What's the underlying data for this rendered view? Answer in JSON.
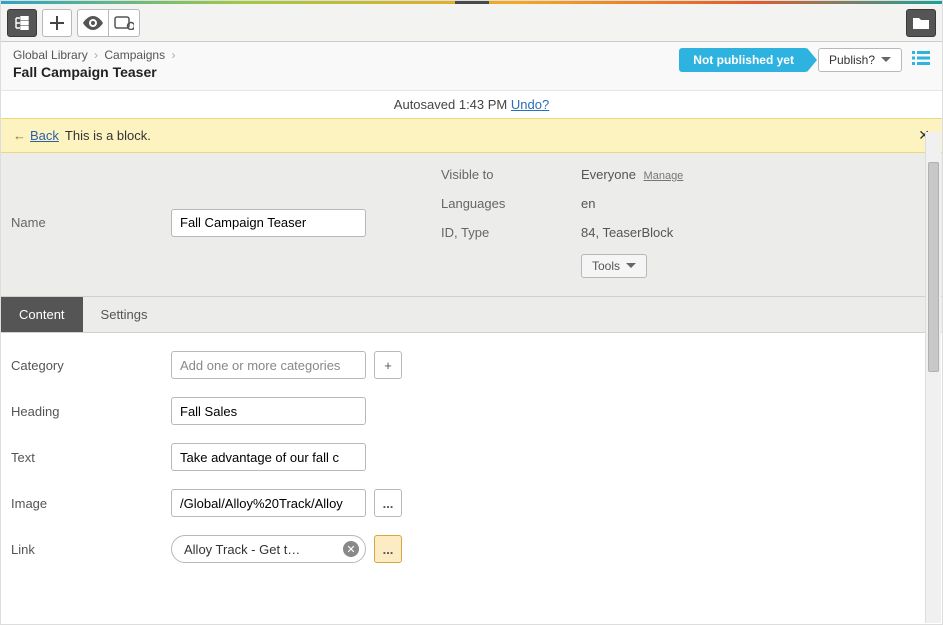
{
  "breadcrumb": {
    "a": "Global Library",
    "b": "Campaigns"
  },
  "page": {
    "title": "Fall Campaign Teaser"
  },
  "status": {
    "pill": "Not published yet",
    "publish": "Publish?"
  },
  "autosave": {
    "prefix": "Autosaved 1:43 PM",
    "undo": "Undo?"
  },
  "notice": {
    "back": "Back",
    "text": "This is a block."
  },
  "props": {
    "name_label": "Name",
    "name_value": "Fall Campaign Teaser",
    "visible_label": "Visible to",
    "visible_value": "Everyone",
    "manage": "Manage",
    "lang_label": "Languages",
    "lang_value": "en",
    "idtype_label": "ID, Type",
    "idtype_value": "84, TeaserBlock",
    "tools": "Tools"
  },
  "tabs": {
    "content": "Content",
    "settings": "Settings"
  },
  "form": {
    "category_label": "Category",
    "category_placeholder": "Add one or more categories",
    "heading_label": "Heading",
    "heading_value": "Fall Sales",
    "text_label": "Text",
    "text_value": "Take advantage of our fall c",
    "image_label": "Image",
    "image_value": "/Global/Alloy%20Track/Alloy",
    "link_label": "Link",
    "link_value": "Alloy Track - Get t…",
    "dots": "...",
    "plus": "+"
  }
}
